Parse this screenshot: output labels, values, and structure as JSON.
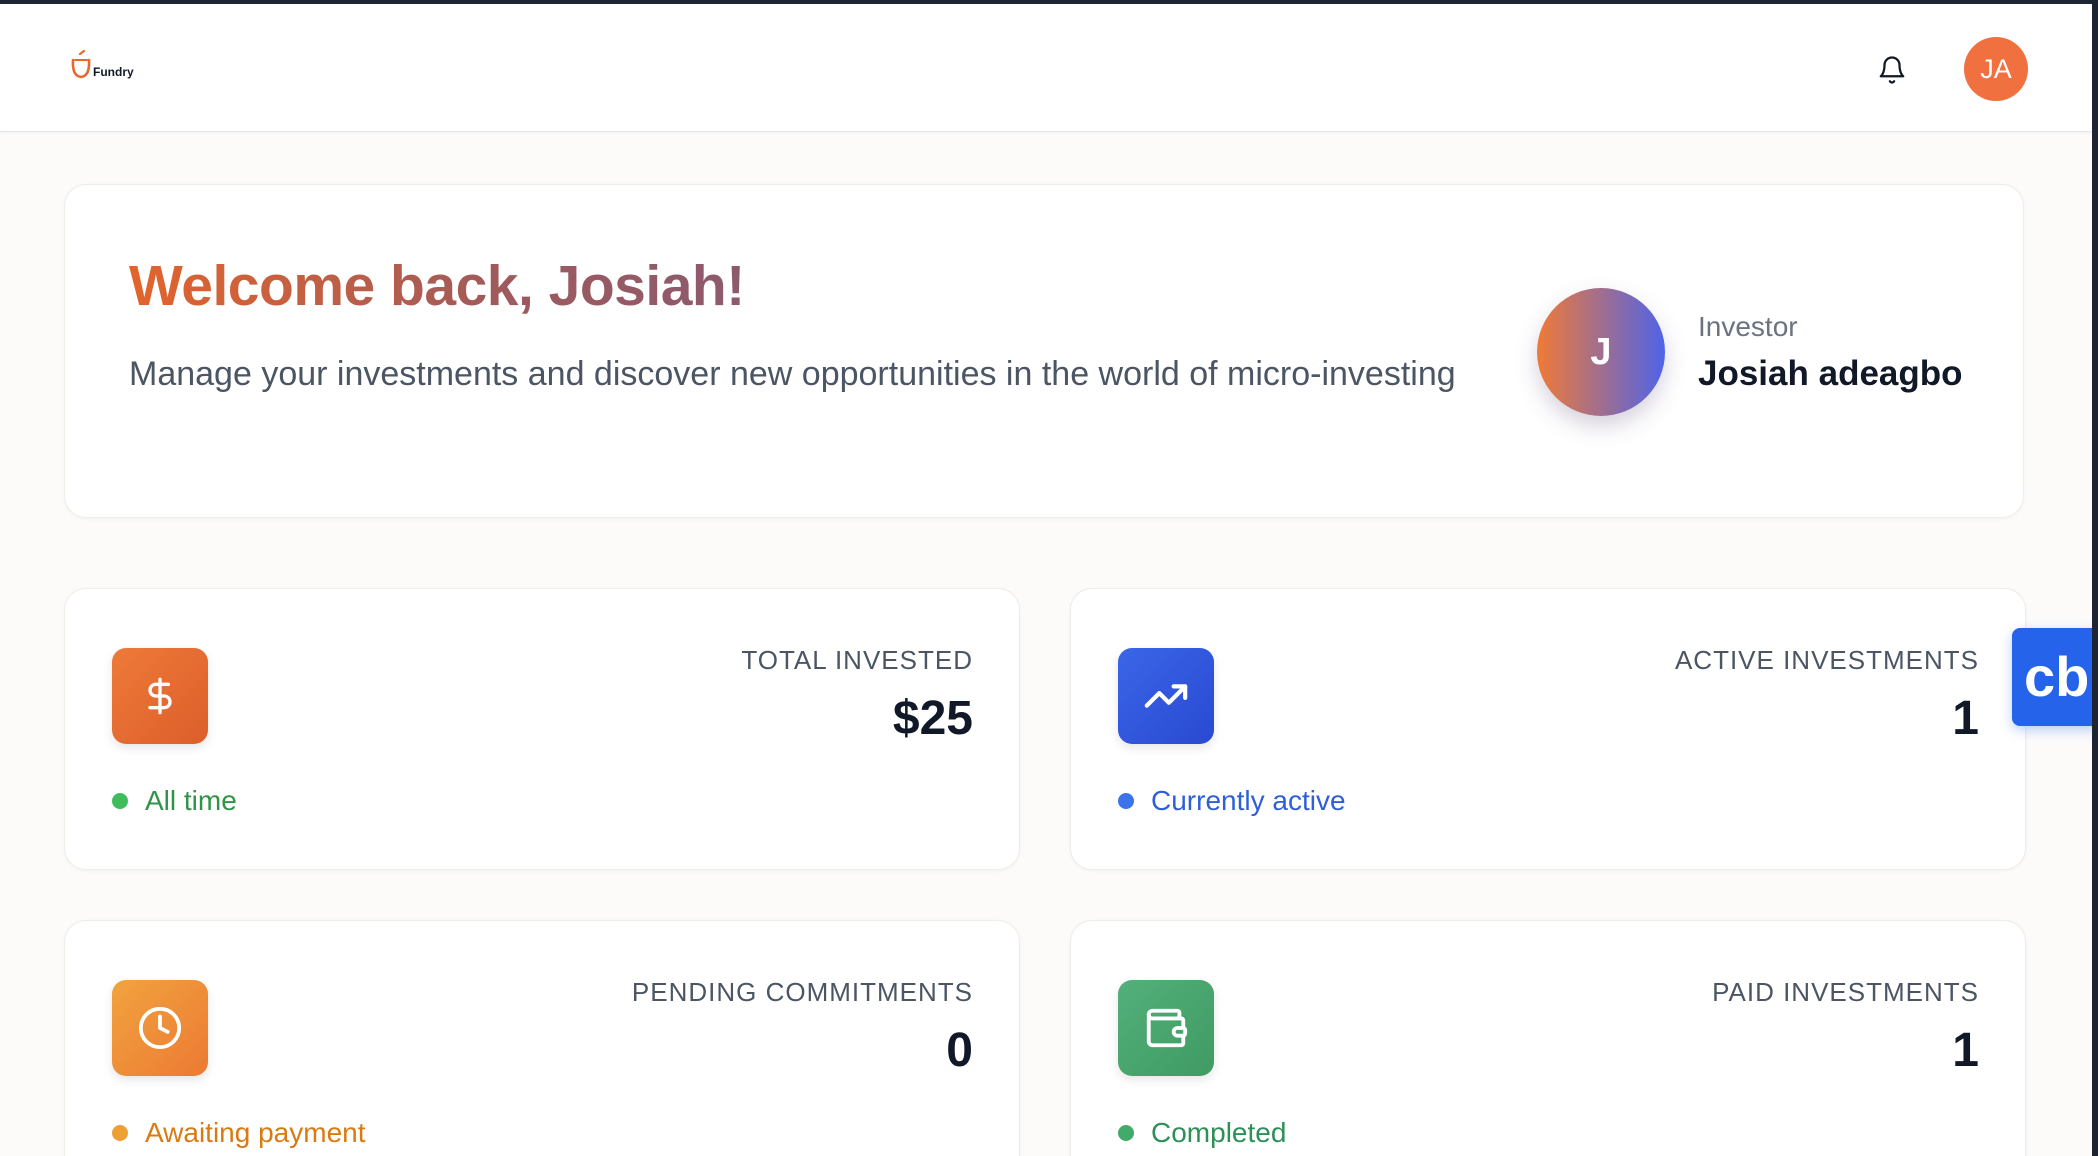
{
  "brand": {
    "name": "Fundry",
    "logo_icon": "fundry-cup-logo",
    "accent": "#f0703f"
  },
  "header": {
    "notification_icon": "bell-icon",
    "avatar_initials": "JA",
    "avatar_color": "#f0703f"
  },
  "welcome": {
    "title": "Welcome back, Josiah!",
    "subtitle": "Manage your investments and discover new opportunities in the world of micro-investing",
    "avatar_initial": "J",
    "role": "Investor",
    "name": "Josiah adeagbo"
  },
  "stats": [
    {
      "label": "TOTAL INVESTED",
      "value": "$25",
      "note": "All time",
      "icon": "dollar-icon",
      "color": "#e86a30"
    },
    {
      "label": "ACTIVE INVESTMENTS",
      "value": "1",
      "note": "Currently active",
      "icon": "trending-up-icon",
      "color": "#2f57dc"
    },
    {
      "label": "PENDING COMMITMENTS",
      "value": "0",
      "note": "Awaiting payment",
      "icon": "clock-icon",
      "color": "#ee8a36"
    },
    {
      "label": "PAID INVESTMENTS",
      "value": "1",
      "note": "Completed",
      "icon": "wallet-icon",
      "color": "#48a66e"
    }
  ],
  "floating_widget": {
    "label": "cb",
    "color": "#2563eb"
  }
}
